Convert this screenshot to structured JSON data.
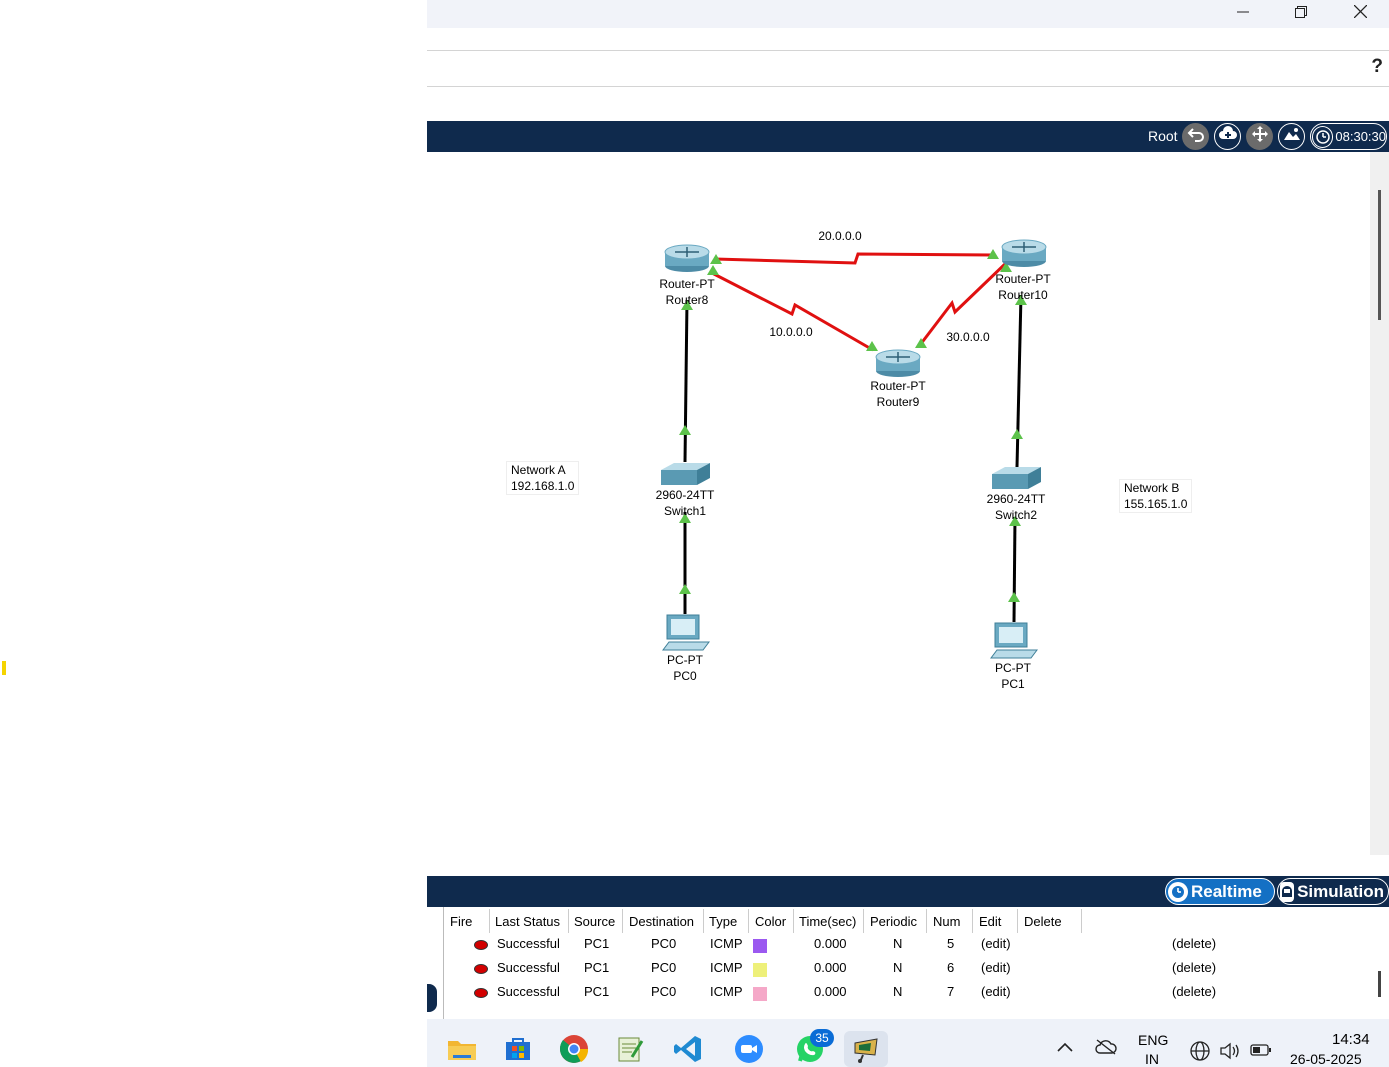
{
  "window": {
    "minimize_icon": "minimize-icon",
    "restore_icon": "restore-icon",
    "close_icon": "close-icon",
    "help_label": "?"
  },
  "topbar": {
    "root_label": "Root",
    "time": "08:30:30",
    "icons": [
      "back-icon",
      "cloud-add-icon",
      "move-icon",
      "image-icon",
      "clock-icon"
    ]
  },
  "topology": {
    "devices": [
      {
        "model": "Router-PT",
        "name": "Router8"
      },
      {
        "model": "Router-PT",
        "name": "Router9"
      },
      {
        "model": "Router-PT",
        "name": "Router10"
      },
      {
        "model": "2960-24TT",
        "name": "Switch1"
      },
      {
        "model": "2960-24TT",
        "name": "Switch2"
      },
      {
        "model": "PC-PT",
        "name": "PC0"
      },
      {
        "model": "PC-PT",
        "name": "PC1"
      }
    ],
    "links": [
      "20.0.0.0",
      "10.0.0.0",
      "30.0.0.0"
    ],
    "network_a": {
      "name": "Network A",
      "ip": "192.168.1.0"
    },
    "network_b": {
      "name": "Network B",
      "ip": "155.165.1.0"
    }
  },
  "modes": {
    "realtime": "Realtime",
    "simulation": "Simulation"
  },
  "pdu_table": {
    "headers": [
      "Fire",
      "Last Status",
      "Source",
      "Destination",
      "Type",
      "Color",
      "Time(sec)",
      "Periodic",
      "Num",
      "Edit",
      "Delete"
    ],
    "rows": [
      {
        "status": "Successful",
        "source": "PC1",
        "destination": "PC0",
        "type": "ICMP",
        "color": "#9b59f0",
        "time": "0.000",
        "periodic": "N",
        "num": "5",
        "edit": "(edit)",
        "delete": "(delete)"
      },
      {
        "status": "Successful",
        "source": "PC1",
        "destination": "PC0",
        "type": "ICMP",
        "color": "#eef07a",
        "time": "0.000",
        "periodic": "N",
        "num": "6",
        "edit": "(edit)",
        "delete": "(delete)"
      },
      {
        "status": "Successful",
        "source": "PC1",
        "destination": "PC0",
        "type": "ICMP",
        "color": "#f5a8c8",
        "time": "0.000",
        "periodic": "N",
        "num": "7",
        "edit": "(edit)",
        "delete": "(delete)"
      }
    ]
  },
  "taskbar": {
    "apps": [
      "file-explorer-icon",
      "store-icon",
      "chrome-icon",
      "notepad-icon",
      "vscode-icon",
      "zoom-icon",
      "whatsapp-icon",
      "packet-tracer-icon"
    ],
    "whatsapp_badge": "35",
    "lang_top": "ENG",
    "lang_bottom": "IN",
    "clock_time": "14:34",
    "clock_date": "26-05-2025"
  }
}
